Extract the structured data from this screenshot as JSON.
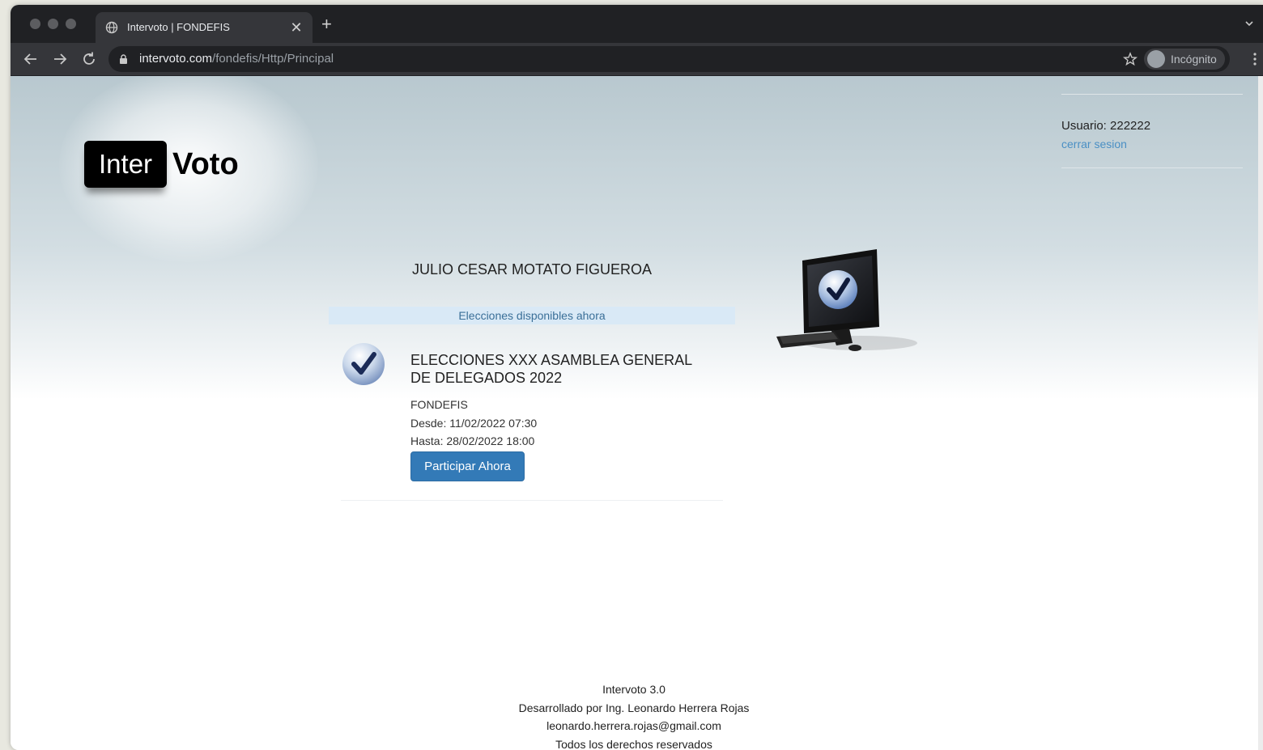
{
  "browser": {
    "tab_title": "Intervoto | FONDEFIS",
    "url_host": "intervoto.com",
    "url_path": "/fondefis/Http/Principal",
    "incognito_label": "Incógnito"
  },
  "header": {
    "logo_left": "Inter",
    "logo_right": "Voto",
    "user_label": "Usuario: 222222",
    "logout_link": "cerrar sesion"
  },
  "main": {
    "voter_name": "JULIO CESAR MOTATO FIGUEROA",
    "available_label": "Elecciones disponibles ahora",
    "elections": [
      {
        "title": "ELECCIONES XXX ASAMBLEA GENERAL DE DELEGADOS 2022",
        "organization": "FONDEFIS",
        "from": "Desde: 11/02/2022 07:30",
        "to": "Hasta: 28/02/2022 18:00",
        "button_label": "Participar Ahora"
      }
    ]
  },
  "footer": {
    "version": "Intervoto 3.0",
    "developer": "Desarrollado por Ing. Leonardo Herrera Rojas",
    "email": "leonardo.herrera.rojas@gmail.com",
    "rights": "Todos los derechos reservados"
  },
  "colors": {
    "chrome_dark": "#202124",
    "button_primary": "#337ab7",
    "link": "#4a8fc4",
    "available_bar": "#d9e9f6"
  },
  "icons": [
    "globe-icon",
    "close-icon",
    "plus-icon",
    "back-icon",
    "forward-icon",
    "reload-icon",
    "lock-icon",
    "star-icon",
    "incognito-icon",
    "kebab-menu-icon",
    "check-icon",
    "computer-icon"
  ]
}
